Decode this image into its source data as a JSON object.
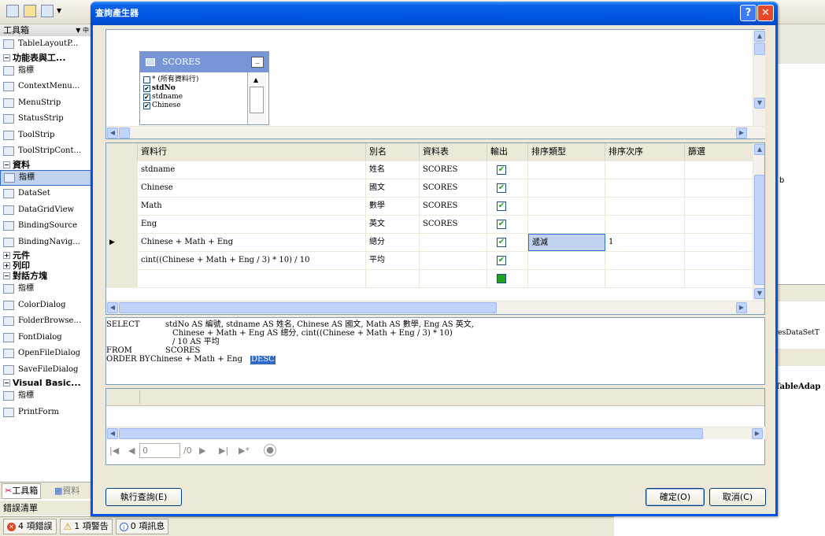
{
  "toolbox": {
    "title": "工具箱",
    "items": [
      {
        "kind": "item",
        "label": "TableLayoutP..."
      },
      {
        "kind": "header",
        "label": "功能表與工..."
      },
      {
        "kind": "item",
        "label": "指標"
      },
      {
        "kind": "item",
        "label": "ContextMenu..."
      },
      {
        "kind": "item",
        "label": "MenuStrip"
      },
      {
        "kind": "item",
        "label": "StatusStrip"
      },
      {
        "kind": "item",
        "label": "ToolStrip"
      },
      {
        "kind": "item",
        "label": "ToolStripCont..."
      },
      {
        "kind": "header",
        "label": "資料"
      },
      {
        "kind": "item",
        "label": "指標",
        "selected": true
      },
      {
        "kind": "item",
        "label": "DataSet"
      },
      {
        "kind": "item",
        "label": "DataGridView"
      },
      {
        "kind": "item",
        "label": "BindingSource"
      },
      {
        "kind": "item",
        "label": "BindingNavig..."
      },
      {
        "kind": "header",
        "label": "元件",
        "collapsed": true
      },
      {
        "kind": "header",
        "label": "列印",
        "collapsed": true
      },
      {
        "kind": "header",
        "label": "對話方塊"
      },
      {
        "kind": "item",
        "label": "指標"
      },
      {
        "kind": "item",
        "label": "ColorDialog"
      },
      {
        "kind": "item",
        "label": "FolderBrowse..."
      },
      {
        "kind": "item",
        "label": "FontDialog"
      },
      {
        "kind": "item",
        "label": "OpenFileDialog"
      },
      {
        "kind": "item",
        "label": "SaveFileDialog"
      },
      {
        "kind": "header",
        "label": "Visual Basic..."
      },
      {
        "kind": "item",
        "label": "指標"
      },
      {
        "kind": "item",
        "label": "PrintForm"
      }
    ],
    "tabs": [
      "工具箱",
      "資料"
    ]
  },
  "errorlist": {
    "title": "錯誤清單",
    "errors": "4 項錯誤",
    "warnings": "1 項警告",
    "messages": "0 項訊息"
  },
  "rightpane": {
    "frag1": "b",
    "frag2": "resDataSetT",
    "frag3": "TableAdap"
  },
  "dialog": {
    "title": "查詢產生器",
    "help_glyph": "?",
    "close_glyph": "✕",
    "table": {
      "name": "SCORES",
      "columns": [
        {
          "label": "* (所有資料行)",
          "checked": false,
          "bold": false
        },
        {
          "label": "stdNo",
          "checked": true,
          "bold": true
        },
        {
          "label": "stdname",
          "checked": true,
          "bold": false
        },
        {
          "label": "Chinese",
          "checked": true,
          "bold": false
        }
      ]
    },
    "grid": {
      "headers": [
        "資料行",
        "別名",
        "資料表",
        "輸出",
        "排序類型",
        "排序次序",
        "篩選"
      ],
      "rows": [
        {
          "column": "stdname",
          "alias": "姓名",
          "table": "SCORES",
          "output": true,
          "sort_type": "",
          "sort_order": ""
        },
        {
          "column": "Chinese",
          "alias": "國文",
          "table": "SCORES",
          "output": true,
          "sort_type": "",
          "sort_order": ""
        },
        {
          "column": "Math",
          "alias": "數學",
          "table": "SCORES",
          "output": true,
          "sort_type": "",
          "sort_order": ""
        },
        {
          "column": "Eng",
          "alias": "英文",
          "table": "SCORES",
          "output": true,
          "sort_type": "",
          "sort_order": ""
        },
        {
          "column": "Chinese + Math + Eng",
          "alias": "總分",
          "table": "",
          "output": true,
          "sort_type": "遞減",
          "sort_order": "1",
          "current": true
        },
        {
          "column": "cint((Chinese + Math + Eng / 3) * 10) / 10",
          "alias": "平均",
          "table": "",
          "output": true,
          "sort_type": "",
          "sort_order": ""
        },
        {
          "column": "",
          "alias": "",
          "table": "",
          "output": null,
          "sort_type": "",
          "sort_order": ""
        }
      ]
    },
    "sql": {
      "kw_select": "SELECT",
      "line1": "stdNo AS 編號, stdname AS 姓名, Chinese AS 國文, Math AS 數學, Eng AS 英文,",
      "line2": "Chinese + Math + Eng AS 總分, cint((Chinese + Math + Eng / 3) * 10)",
      "line3": "/ 10 AS 平均",
      "kw_from": "FROM",
      "from_table": "SCORES",
      "kw_order": "ORDER BY",
      "order_expr": "Chinese + Math + Eng",
      "order_dir": "DESC"
    },
    "nav": {
      "record_value": "0",
      "record_total": "/0"
    },
    "buttons": {
      "execute": "執行查詢(E)",
      "ok": "確定(O)",
      "cancel": "取消(C)"
    }
  },
  "colors": {
    "titlebar": "#0054e3",
    "selection": "#316ac5",
    "table_header": "#7896d6"
  }
}
